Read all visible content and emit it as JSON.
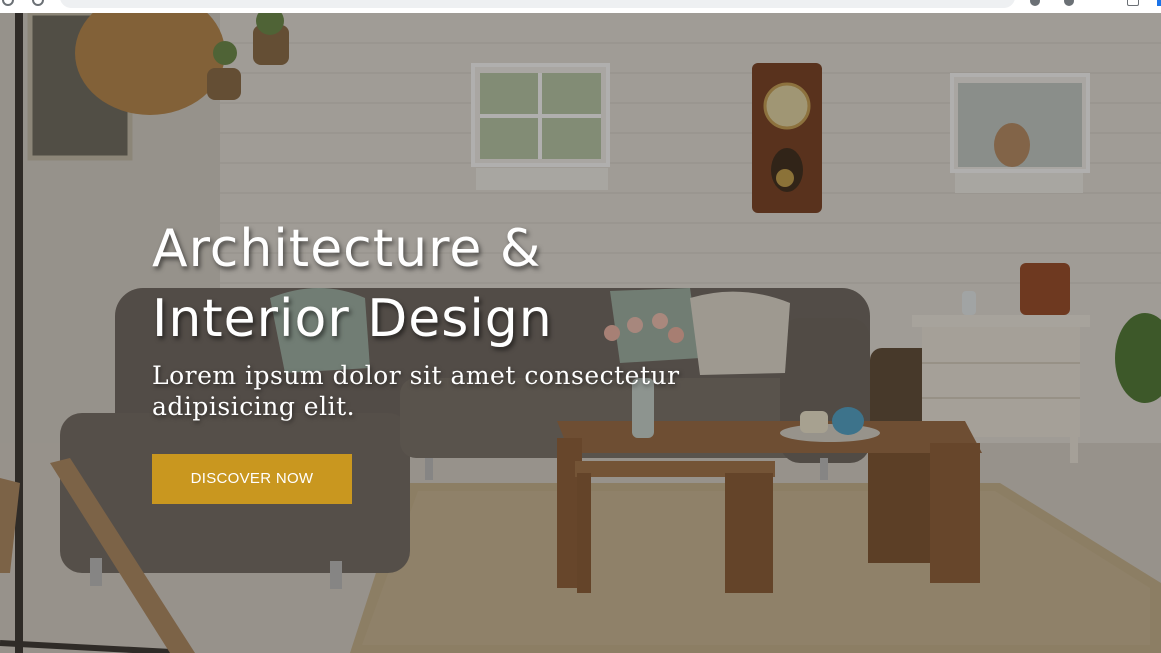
{
  "hero": {
    "title_line1": "Architecture &",
    "title_line2": "Interior Design",
    "subtitle_line1": "Lorem ipsum dolor sit amet consectetur",
    "subtitle_line2": "adipisicing elit.",
    "cta_label": "DISCOVER NOW"
  },
  "colors": {
    "accent": "#c9971f",
    "text_light": "#ffffff",
    "overlay": "rgba(30,26,22,0.35)"
  },
  "icons": [
    "back-icon",
    "forward-icon",
    "extension-icon",
    "page-icon"
  ]
}
